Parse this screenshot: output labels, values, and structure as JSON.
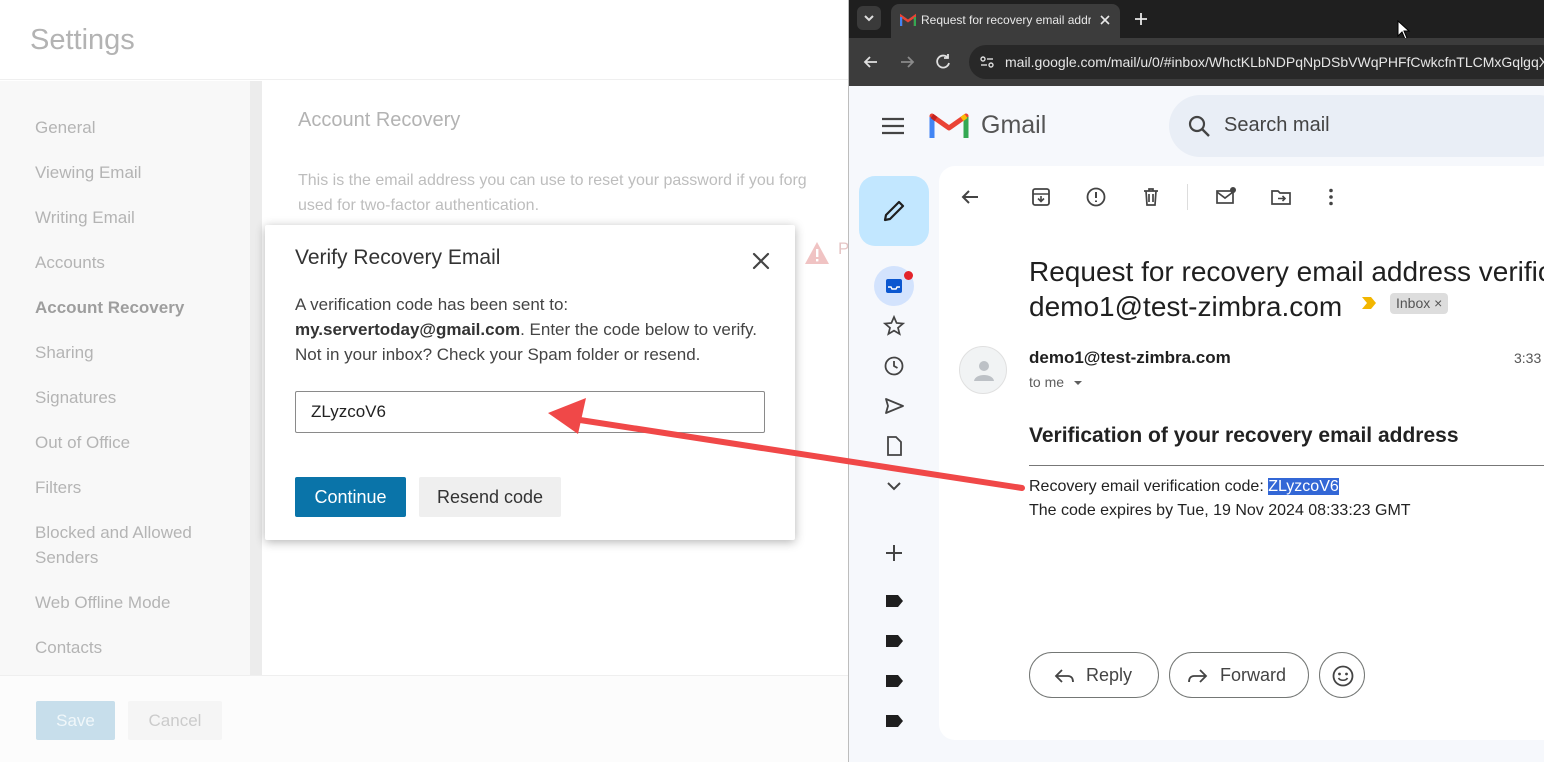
{
  "zimbra": {
    "title": "Settings",
    "sidebar": [
      {
        "label": "General"
      },
      {
        "label": "Viewing Email"
      },
      {
        "label": "Writing Email"
      },
      {
        "label": "Accounts"
      },
      {
        "label": "Account Recovery",
        "active": true
      },
      {
        "label": "Sharing"
      },
      {
        "label": "Signatures"
      },
      {
        "label": "Out of Office"
      },
      {
        "label": "Filters"
      },
      {
        "label": "Blocked and Allowed Senders"
      },
      {
        "label": "Web Offline Mode"
      },
      {
        "label": "Contacts"
      }
    ],
    "section_title": "Account Recovery",
    "description_line1": "This is the email address you can use to reset your password if you forg",
    "description_line2": "used for two-factor authentication.",
    "warning_text": "P",
    "save_label": "Save",
    "cancel_label": "Cancel"
  },
  "dialog": {
    "title": "Verify Recovery Email",
    "body_line1": "A verification code has been sent to:",
    "email": "my.servertoday@gmail.com",
    "body_line2_rest": ". Enter the code below to verify.",
    "body_line3": "Not in your inbox? Check your Spam folder or resend.",
    "code_value": "ZLyzcoV6",
    "continue_label": "Continue",
    "resend_label": "Resend code"
  },
  "browser": {
    "tab_title": "Request for recovery email addr",
    "url": "mail.google.com/mail/u/0/#inbox/WhctKLbNDPqNpDSbVWqPHFfCwkcfnTLCMxGqlgqX"
  },
  "gmail": {
    "logo_text": "Gmail",
    "search_placeholder": "Search mail",
    "subject_line1": "Request for recovery email address verific",
    "subject_line2": "demo1@test-zimbra.com",
    "label": "Inbox",
    "sender": "demo1@test-zimbra.com",
    "time": "3:33",
    "to_me": "to me",
    "heading": "Verification of your recovery email address",
    "code_label": "Recovery email verification code: ",
    "code": "ZLyzcoV6",
    "expiry": "The code expires by Tue, 19 Nov 2024 08:33:23 GMT",
    "reply_label": "Reply",
    "forward_label": "Forward"
  },
  "colors": {
    "annotation_arrow": "#f04848",
    "continue_button": "#0a74a9",
    "compose_button": "#c2e7ff"
  }
}
